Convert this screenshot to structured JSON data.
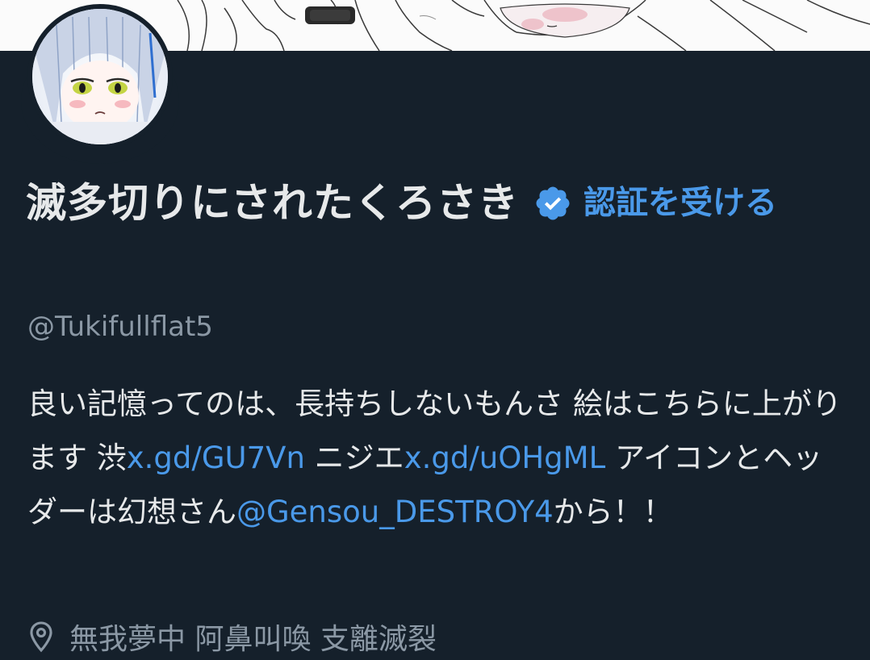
{
  "profile": {
    "display_name": "滅多切りにされたくろさき",
    "verify_label": "認証を受ける",
    "handle": "@Tukifullflat5",
    "bio": {
      "text_1": "良い記憶ってのは、長持ちしないもんさ 絵はこちらに上がります 渋",
      "link_1": "x.gd/GU7Vn",
      "text_2": " ニジエ",
      "link_2": "x.gd/uOHgML",
      "text_3": " アイコンとヘッダーは幻想さん",
      "mention": "@Gensou_DESTROY4",
      "text_4": "から！！"
    },
    "location": "無我夢中 阿鼻叫喚 支離滅裂"
  },
  "icons": {
    "verified": "verified-badge-icon",
    "location": "location-pin-icon"
  },
  "colors": {
    "background": "#15202b",
    "primary_text": "#e7e9ea",
    "secondary_text": "#8b98a5",
    "accent": "#4a99e9"
  }
}
